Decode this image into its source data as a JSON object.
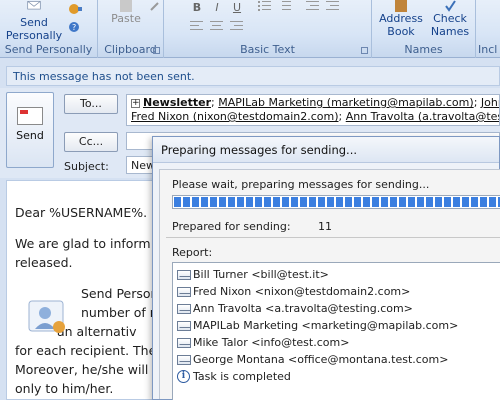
{
  "ribbon": {
    "send_personally": {
      "line1": "Send",
      "line2": "Personally"
    },
    "groups": {
      "send_personally": "Send Personally",
      "clipboard": "Clipboard",
      "basic_text": "Basic Text",
      "names": "Names",
      "include": "Incl"
    },
    "paste_label": "Paste",
    "format_buttons": [
      "B",
      "I",
      "U"
    ],
    "address_book": {
      "line1": "Address",
      "line2": "Book"
    },
    "check_names": {
      "line1": "Check",
      "line2": "Names"
    }
  },
  "infobar": {
    "text": "This message has not been sent."
  },
  "header": {
    "send_label": "Send",
    "to_button": "To...",
    "cc_button": "Cc...",
    "subject_label": "Subject:",
    "subject_value": "New",
    "to_line1": [
      {
        "text": "Newsletter",
        "bold": true
      },
      {
        "text": "MAPILab Marketing (marketing@mapilab.com)",
        "bold": false
      },
      {
        "text": "John Smith (",
        "bold": false
      }
    ],
    "to_line2": [
      {
        "text": "Fred Nixon (nixon@testdomain2.com)"
      },
      {
        "text": "Ann Travolta (a.travolta@testing.com"
      }
    ]
  },
  "body": {
    "p1": "Dear %USERNAME%.",
    "p2_line1": "We are glad to inform t",
    "p2_line2": "released.",
    "p3_line1": "Send Person",
    "p3_line2": "number of r",
    "p3_line3": "an alternativ",
    "p3_line4": "for each recipient. The",
    "p3_line5": "Moreover, he/she will",
    "p3_line6": "only to him/her."
  },
  "dialog": {
    "title": "Preparing messages for sending...",
    "wait_text": "Please wait, preparing messages for sending...",
    "progress_fraction": 1.0,
    "prepared_label": "Prepared for sending:",
    "prepared_count": "11",
    "report_label": "Report:",
    "report_items": [
      {
        "icon": "mail-icon",
        "text": "Bill Turner <bill@test.it>"
      },
      {
        "icon": "mail-icon",
        "text": "Fred Nixon <nixon@testdomain2.com>"
      },
      {
        "icon": "mail-icon",
        "text": "Ann Travolta <a.travolta@testing.com>"
      },
      {
        "icon": "mail-icon",
        "text": "MAPILab Marketing <marketing@mapilab.com>"
      },
      {
        "icon": "mail-icon",
        "text": "Mike Talor <info@test.com>"
      },
      {
        "icon": "mail-icon",
        "text": "George Montana <office@montana.test.com>"
      },
      {
        "icon": "info-icon",
        "text": "Task is completed"
      }
    ]
  }
}
